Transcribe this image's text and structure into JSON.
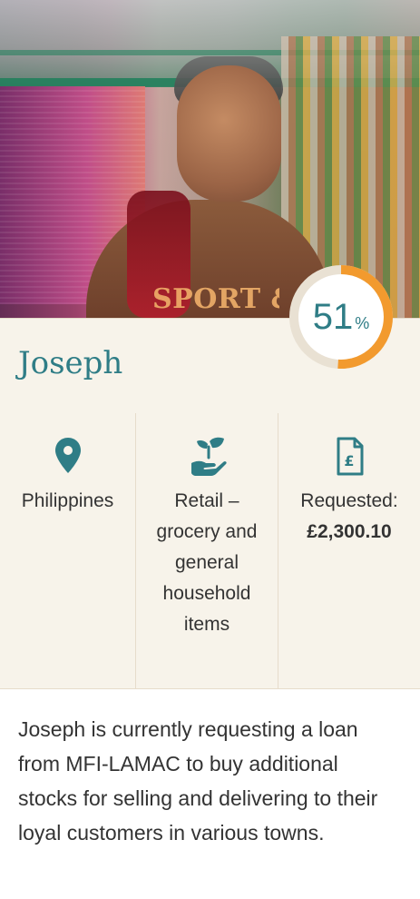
{
  "profile": {
    "name": "Joseph",
    "funded_percent": 51,
    "funded_percent_label": "51",
    "percent_symbol": "%"
  },
  "details": {
    "location": "Philippines",
    "sector": "Retail – grocery and general household items",
    "requested_label": "Requested:",
    "requested_amount": "£2,300.10"
  },
  "description": "Joseph is currently requesting a loan from MFI-LAMAC to buy additional stocks for selling and delivering to their loyal customers in various towns.",
  "photo": {
    "shirt_text": "SPORT & EXP"
  },
  "icons": {
    "location": "map-pin-icon",
    "sector": "hand-plant-icon",
    "requested": "pound-document-icon"
  },
  "colors": {
    "accent_teal": "#2f7d86",
    "progress_orange": "#f29a2e",
    "progress_track": "#e9e1d3",
    "panel_bg": "#f7f3ea"
  }
}
